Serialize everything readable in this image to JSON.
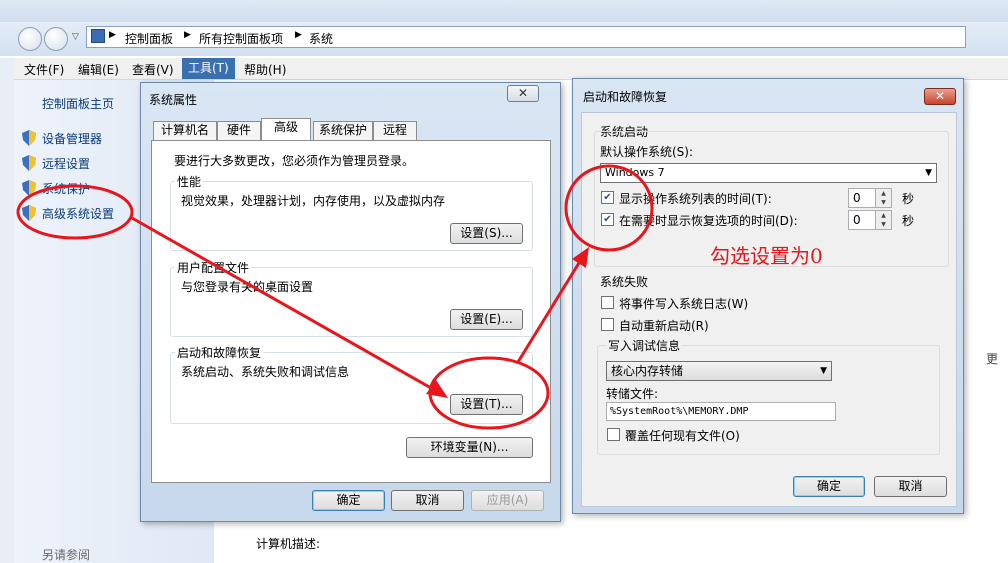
{
  "address_bar": {
    "crumbs": [
      "控制面板",
      "所有控制面板项",
      "系统"
    ]
  },
  "menu": {
    "items": [
      "文件(F)",
      "编辑(E)",
      "查看(V)",
      "工具(T)",
      "帮助(H)"
    ]
  },
  "left_pane": {
    "home": "控制面板主页",
    "links": [
      "设备管理器",
      "远程设置",
      "系统保护",
      "高级系统设置"
    ],
    "see_also": "另请参阅"
  },
  "main": {
    "computer_description": "计算机描述:",
    "partial_right": "更"
  },
  "system_properties": {
    "title": "系统属性",
    "close": "✕",
    "tabs": [
      "计算机名",
      "硬件",
      "高级",
      "系统保护",
      "远程"
    ],
    "admin_note": "要进行大多数更改，您必须作为管理员登录。",
    "performance": {
      "label": "性能",
      "desc": "视觉效果，处理器计划，内存使用，以及虚拟内存",
      "button": "设置(S)..."
    },
    "user_profiles": {
      "label": "用户配置文件",
      "desc": "与您登录有关的桌面设置",
      "button": "设置(E)..."
    },
    "startup_recovery": {
      "label": "启动和故障恢复",
      "desc": "系统启动、系统失败和调试信息",
      "button": "设置(T)..."
    },
    "env_button": "环境变量(N)...",
    "ok": "确定",
    "cancel": "取消",
    "apply": "应用(A)"
  },
  "startup_dialog": {
    "title": "启动和故障恢复",
    "close": "✕",
    "system_startup": {
      "label": "系统启动",
      "default_os_label": "默认操作系统(S):",
      "default_os_value": "Windows 7",
      "show_os_list": {
        "label": "显示操作系统列表的时间(T):",
        "checked": true,
        "value": "0",
        "unit": "秒"
      },
      "show_recovery": {
        "label": "在需要时显示恢复选项的时间(D):",
        "checked": true,
        "value": "0",
        "unit": "秒"
      }
    },
    "system_failure": {
      "label": "系统失败",
      "write_event": {
        "label": "将事件写入系统日志(W)",
        "checked": false
      },
      "auto_restart": {
        "label": "自动重新启动(R)",
        "checked": false
      }
    },
    "debug_info": {
      "label": "写入调试信息",
      "dump_type": "核心内存转储",
      "dump_file_label": "转储文件:",
      "dump_file_value": "%SystemRoot%\\MEMORY.DMP",
      "overwrite": {
        "label": "覆盖任何现有文件(O)",
        "checked": false
      }
    },
    "ok": "确定",
    "cancel": "取消"
  },
  "annotation": {
    "text": "勾选设置为0",
    "color": "#e8161c"
  }
}
